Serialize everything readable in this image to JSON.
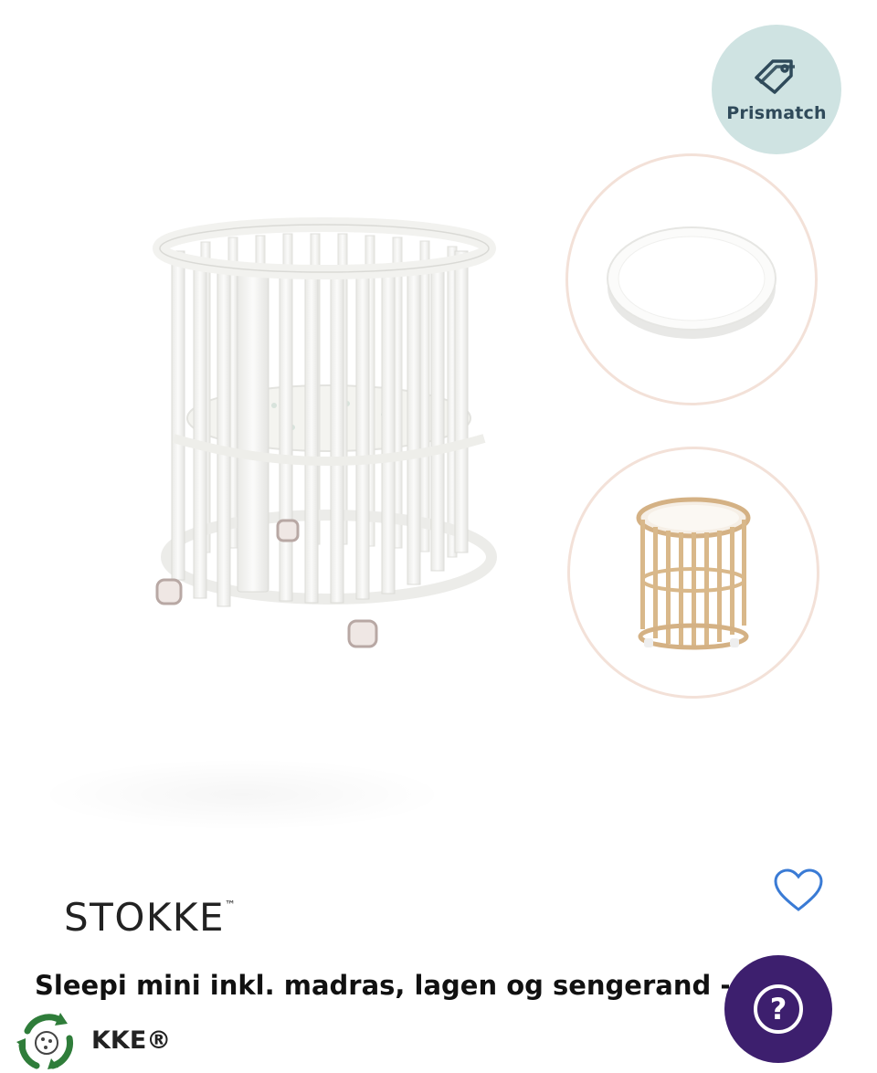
{
  "badge": {
    "label": "Prismatch",
    "icon": "price-tag-icon",
    "bg_color": "#cfe3e2"
  },
  "thumbnails": [
    {
      "name": "mattress",
      "icon": "oval-mattress-image"
    },
    {
      "name": "natural-variant",
      "icon": "natural-crib-image"
    }
  ],
  "product": {
    "brand": "STOKKE",
    "brand_mark": "™",
    "title": "Sleepi mini inkl. madras, lagen og sengerand - W",
    "sub_brand": "KKE®"
  },
  "actions": {
    "favorite_icon": "heart-icon",
    "help_icon": "question-icon",
    "help_symbol": "?"
  },
  "colors": {
    "help_bg": "#3d1f6e",
    "favorite": "#3a7bd5",
    "badge_text": "#2f4a5a"
  }
}
